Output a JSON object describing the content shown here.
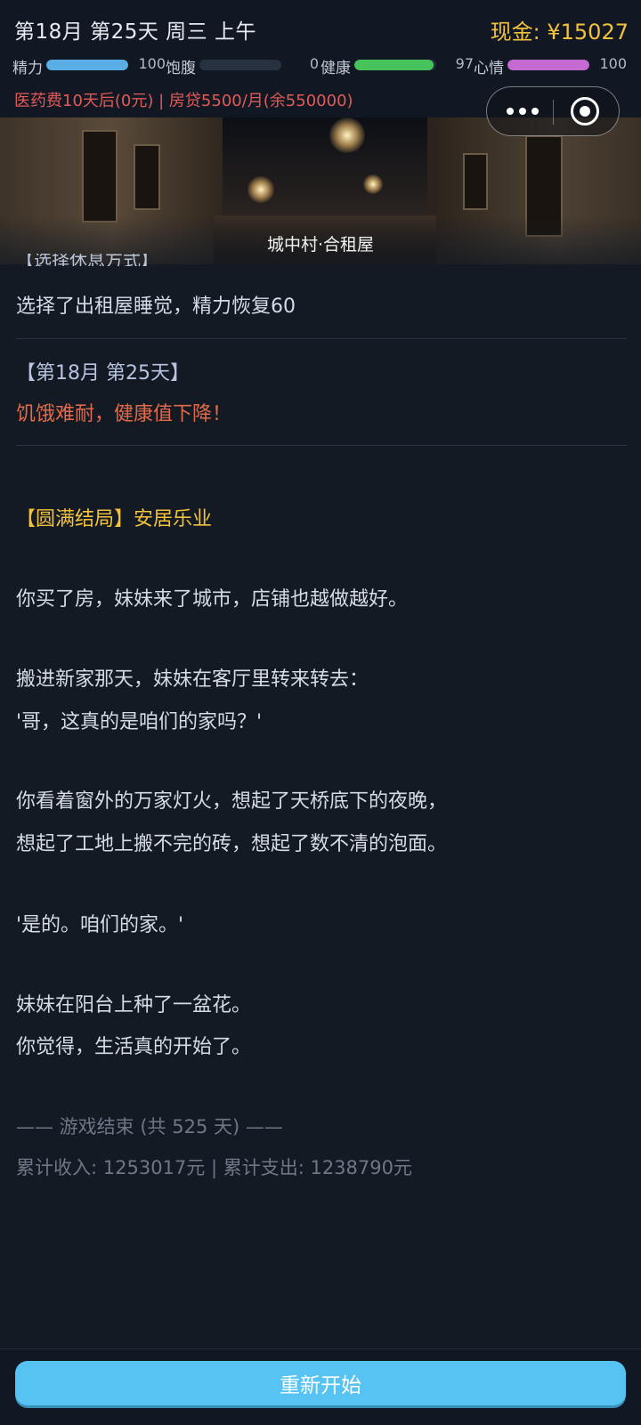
{
  "header": {
    "date": "第18月 第25天 周三 上午",
    "cash": "现金: ¥15027",
    "stats": [
      {
        "label": "精力",
        "value": "100",
        "level": 1.0,
        "color": "#5aaee6"
      },
      {
        "label": "饱腹",
        "value": "0",
        "level": 0.0,
        "color": "#e0a050"
      },
      {
        "label": "健康",
        "value": "97",
        "level": 0.97,
        "color": "#46c35a"
      },
      {
        "label": "心情",
        "value": "100",
        "level": 1.0,
        "color": "#c56ad0"
      }
    ],
    "notices": "医药费10天后(0元)  |  房贷5500/月(余550000)"
  },
  "banner": {
    "caption": "城中村·合租屋"
  },
  "log": {
    "cut_title": "【选择休息方式】",
    "rest_text": "选择了出租屋睡觉，精力恢复60",
    "day_title": "【第18月 第25天】",
    "warning": "饥饿难耐，健康值下降！",
    "ending_title": "【圆满结局】安居乐业",
    "story": [
      "你买了房，妹妹来了城市，店铺也越做越好。",
      "搬进新家那天，妹妹在客厅里转来转去：",
      "'哥，这真的是咱们的家吗？'",
      "你看着窗外的万家灯火，想起了天桥底下的夜晚，",
      "想起了工地上搬不完的砖，想起了数不清的泡面。",
      "'是的。咱们的家。'",
      "妹妹在阳台上种了一盆花。",
      "你觉得，生活真的开始了。"
    ],
    "game_over": "—— 游戏结束 (共 525 天) ——",
    "totals": "累计收入: 1253017元 | 累计支出: 1238790元"
  },
  "footer": {
    "restart_label": "重新开始"
  }
}
